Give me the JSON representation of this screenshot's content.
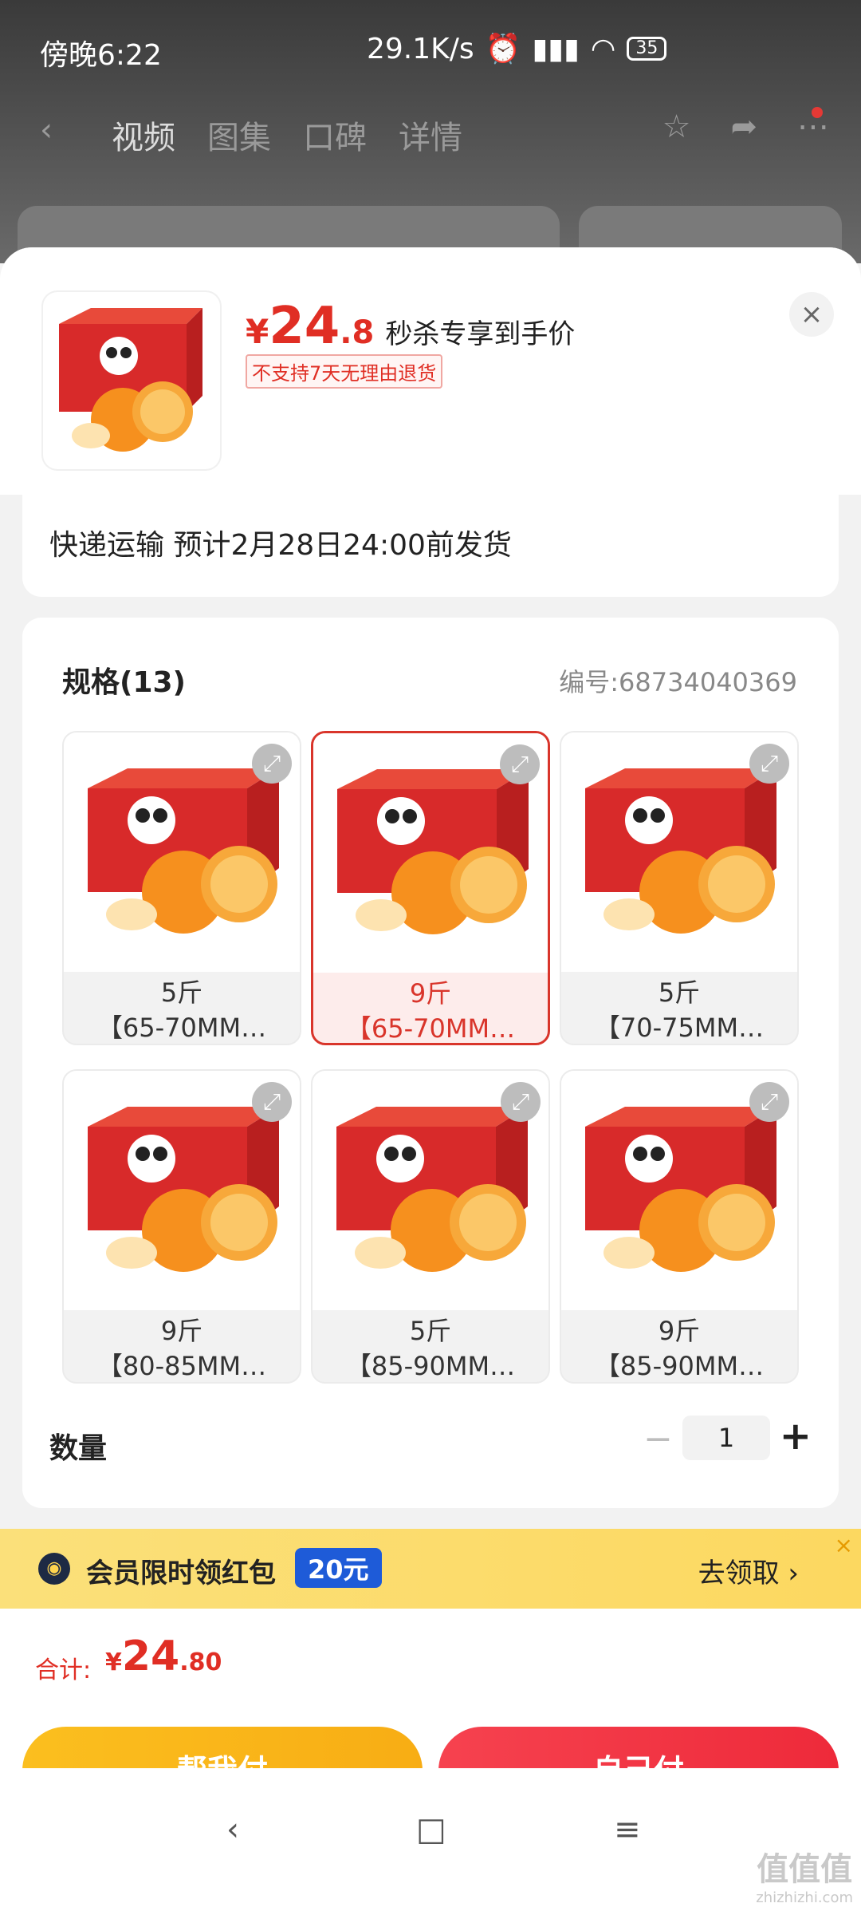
{
  "status_bar": {
    "time": "傍晚6:22",
    "speed": "29.1K/s",
    "battery": "35"
  },
  "top_nav": {
    "tabs": [
      "视频",
      "图集",
      "口碑",
      "详情"
    ]
  },
  "product": {
    "price_symbol": "¥",
    "price_int": "24",
    "price_dec": ".8",
    "price_note": "秒杀专享到手价",
    "return_tag": "不支持7天无理由退货",
    "close": "×"
  },
  "shipping": {
    "text": "快递运输 预计2月28日24:00前发货"
  },
  "spec": {
    "title": "规格(13)",
    "code": "编号:68734040369",
    "items": [
      {
        "line1": "5斤",
        "line2": "【65-70MM…"
      },
      {
        "line1": "9斤",
        "line2": "【65-70MM…"
      },
      {
        "line1": "5斤",
        "line2": "【70-75MM…"
      },
      {
        "line1": "9斤",
        "line2": "【80-85MM…"
      },
      {
        "line1": "5斤",
        "line2": "【85-90MM…"
      },
      {
        "line1": "9斤",
        "line2": "【85-90MM…"
      }
    ],
    "selected_index": 1
  },
  "quantity": {
    "label": "数量",
    "value": "1",
    "minus": "−",
    "plus": "+"
  },
  "promo": {
    "text": "会员限时领红包",
    "badge": "20元",
    "action": "去领取 ›",
    "close": "×"
  },
  "total": {
    "label": "合计:",
    "symbol": "¥",
    "int": "24",
    "dec": ".80"
  },
  "buttons": {
    "help_pay": "帮我付",
    "self_pay": "自己付"
  },
  "system_nav": {
    "back": "‹",
    "home": "□",
    "menu": "≡"
  },
  "watermark": {
    "text": "值值值",
    "sub": "zhizhizhi.com"
  },
  "colors": {
    "accent_red": "#e02e24",
    "pay_yellow": "#fbbf1f",
    "pay_red": "#f6424f",
    "badge_blue": "#1e5bd8"
  }
}
